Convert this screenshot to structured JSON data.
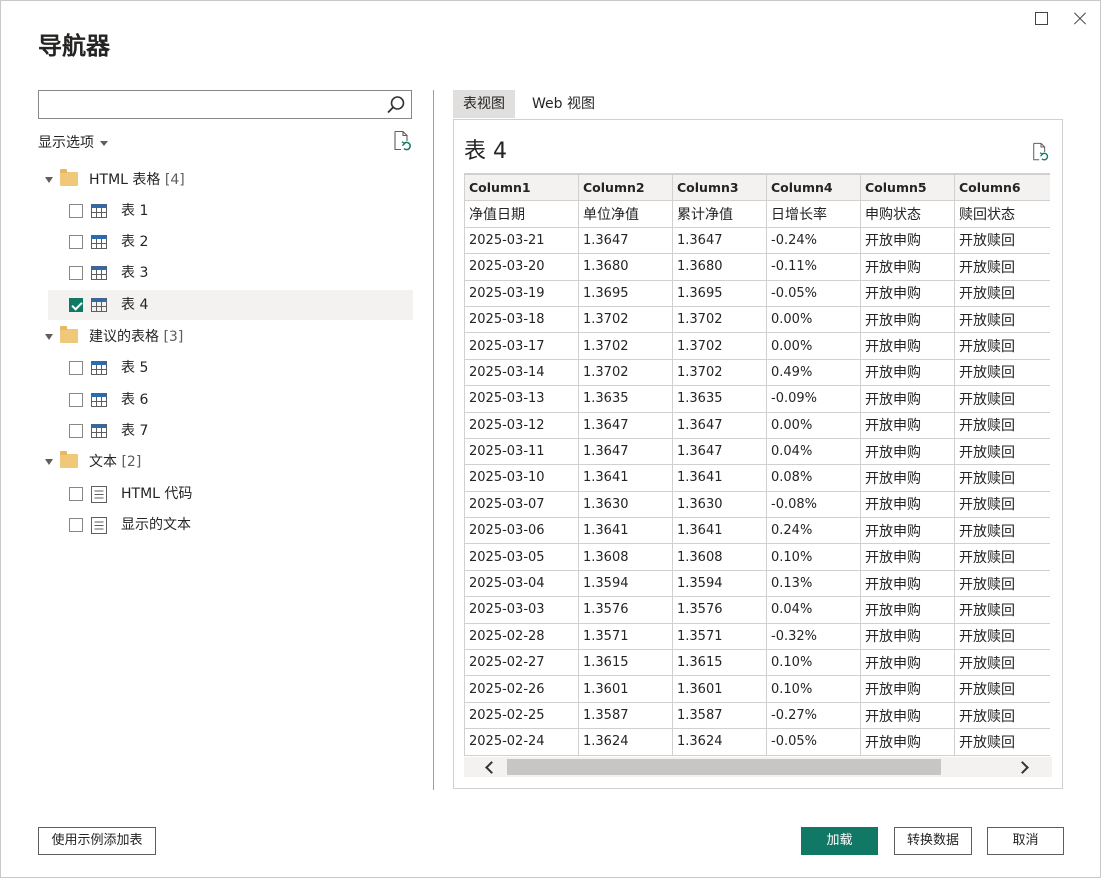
{
  "window": {
    "title": "导航器"
  },
  "left": {
    "search": {
      "value": "",
      "placeholder": ""
    },
    "display_options": "显示选项",
    "tree": {
      "groups": [
        {
          "name": "HTML 表格",
          "count": "[4]",
          "items": [
            {
              "label": "表 1",
              "checked": false
            },
            {
              "label": "表 2",
              "checked": false
            },
            {
              "label": "表 3",
              "checked": false
            },
            {
              "label": "表 4",
              "checked": true
            }
          ]
        },
        {
          "name": "建议的表格",
          "count": "[3]",
          "items": [
            {
              "label": "表 5",
              "checked": false
            },
            {
              "label": "表 6",
              "checked": false
            },
            {
              "label": "表 7",
              "checked": false
            }
          ]
        },
        {
          "name": "文本",
          "count": "[2]",
          "items": [
            {
              "label": "HTML 代码",
              "checked": false
            },
            {
              "label": "显示的文本",
              "checked": false
            }
          ]
        }
      ]
    }
  },
  "right": {
    "tabs": [
      {
        "label": "表视图",
        "active": true
      },
      {
        "label": "Web 视图",
        "active": false
      }
    ],
    "preview_title": "表 4",
    "table": {
      "columns": [
        "Column1",
        "Column2",
        "Column3",
        "Column4",
        "Column5",
        "Column6"
      ],
      "rows": [
        [
          "净值日期",
          "单位净值",
          "累计净值",
          "日增长率",
          "申购状态",
          "赎回状态"
        ],
        [
          "2025-03-21",
          "1.3647",
          "1.3647",
          "-0.24%",
          "开放申购",
          "开放赎回"
        ],
        [
          "2025-03-20",
          "1.3680",
          "1.3680",
          "-0.11%",
          "开放申购",
          "开放赎回"
        ],
        [
          "2025-03-19",
          "1.3695",
          "1.3695",
          "-0.05%",
          "开放申购",
          "开放赎回"
        ],
        [
          "2025-03-18",
          "1.3702",
          "1.3702",
          "0.00%",
          "开放申购",
          "开放赎回"
        ],
        [
          "2025-03-17",
          "1.3702",
          "1.3702",
          "0.00%",
          "开放申购",
          "开放赎回"
        ],
        [
          "2025-03-14",
          "1.3702",
          "1.3702",
          "0.49%",
          "开放申购",
          "开放赎回"
        ],
        [
          "2025-03-13",
          "1.3635",
          "1.3635",
          "-0.09%",
          "开放申购",
          "开放赎回"
        ],
        [
          "2025-03-12",
          "1.3647",
          "1.3647",
          "0.00%",
          "开放申购",
          "开放赎回"
        ],
        [
          "2025-03-11",
          "1.3647",
          "1.3647",
          "0.04%",
          "开放申购",
          "开放赎回"
        ],
        [
          "2025-03-10",
          "1.3641",
          "1.3641",
          "0.08%",
          "开放申购",
          "开放赎回"
        ],
        [
          "2025-03-07",
          "1.3630",
          "1.3630",
          "-0.08%",
          "开放申购",
          "开放赎回"
        ],
        [
          "2025-03-06",
          "1.3641",
          "1.3641",
          "0.24%",
          "开放申购",
          "开放赎回"
        ],
        [
          "2025-03-05",
          "1.3608",
          "1.3608",
          "0.10%",
          "开放申购",
          "开放赎回"
        ],
        [
          "2025-03-04",
          "1.3594",
          "1.3594",
          "0.13%",
          "开放申购",
          "开放赎回"
        ],
        [
          "2025-03-03",
          "1.3576",
          "1.3576",
          "0.04%",
          "开放申购",
          "开放赎回"
        ],
        [
          "2025-02-28",
          "1.3571",
          "1.3571",
          "-0.32%",
          "开放申购",
          "开放赎回"
        ],
        [
          "2025-02-27",
          "1.3615",
          "1.3615",
          "0.10%",
          "开放申购",
          "开放赎回"
        ],
        [
          "2025-02-26",
          "1.3601",
          "1.3601",
          "0.10%",
          "开放申购",
          "开放赎回"
        ],
        [
          "2025-02-25",
          "1.3587",
          "1.3587",
          "-0.27%",
          "开放申购",
          "开放赎回"
        ],
        [
          "2025-02-24",
          "1.3624",
          "1.3624",
          "-0.05%",
          "开放申购",
          "开放赎回"
        ]
      ]
    }
  },
  "buttons": {
    "add_by_example": "使用示例添加表",
    "load": "加载",
    "transform": "转换数据",
    "cancel": "取消"
  },
  "colors": {
    "accent": "#117865",
    "selected_row": "#f3f2f1"
  }
}
